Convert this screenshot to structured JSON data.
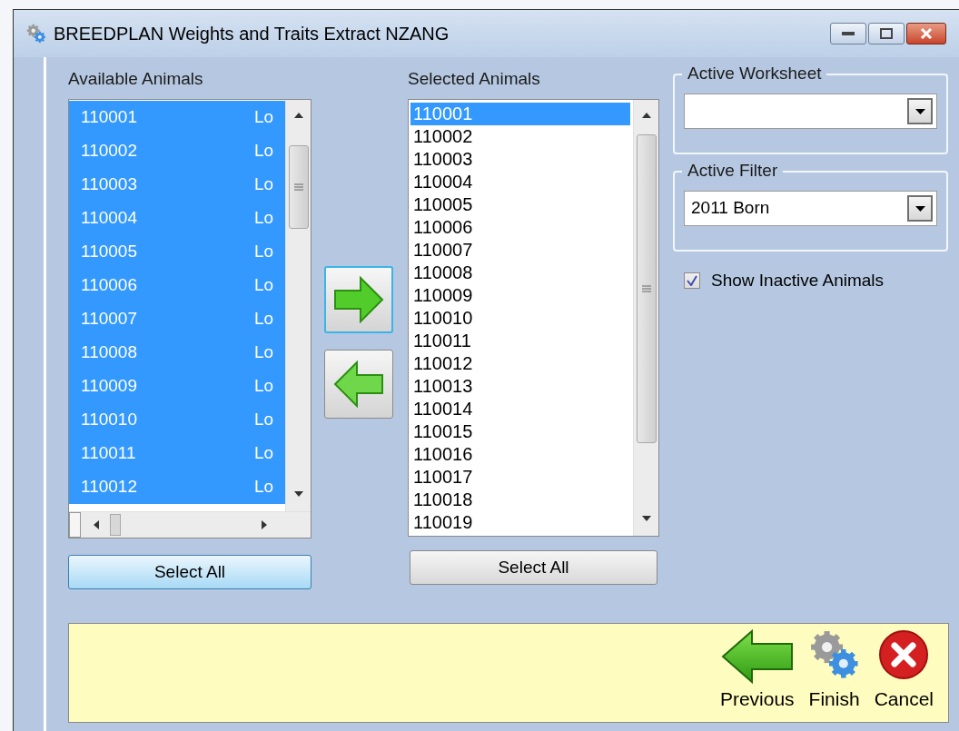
{
  "window": {
    "title": "BREEDPLAN Weights and Traits Extract NZANG"
  },
  "available_animals": {
    "label": "Available Animals",
    "select_all": "Select All",
    "rows": [
      {
        "id": "110001",
        "column_2": "Lo",
        "selected": true
      },
      {
        "id": "110002",
        "column_2": "Lo",
        "selected": true
      },
      {
        "id": "110003",
        "column_2": "Lo",
        "selected": true
      },
      {
        "id": "110004",
        "column_2": "Lo",
        "selected": true
      },
      {
        "id": "110005",
        "column_2": "Lo",
        "selected": true
      },
      {
        "id": "110006",
        "column_2": "Lo",
        "selected": true
      },
      {
        "id": "110007",
        "column_2": "Lo",
        "selected": true
      },
      {
        "id": "110008",
        "column_2": "Lo",
        "selected": true
      },
      {
        "id": "110009",
        "column_2": "Lo",
        "selected": true
      },
      {
        "id": "110010",
        "column_2": "Lo",
        "selected": true
      },
      {
        "id": "110011",
        "column_2": "Lo",
        "selected": true
      },
      {
        "id": "110012",
        "column_2": "Lo",
        "selected": true
      }
    ]
  },
  "selected_animals": {
    "label": "Selected Animals",
    "select_all": "Select All",
    "items": [
      {
        "text": "110001",
        "selected": true
      },
      {
        "text": "110002",
        "selected": false
      },
      {
        "text": "110003",
        "selected": false
      },
      {
        "text": "110004",
        "selected": false
      },
      {
        "text": "110005",
        "selected": false
      },
      {
        "text": "110006",
        "selected": false
      },
      {
        "text": "110007",
        "selected": false
      },
      {
        "text": "110008",
        "selected": false
      },
      {
        "text": "110009",
        "selected": false
      },
      {
        "text": "110010",
        "selected": false
      },
      {
        "text": "110011",
        "selected": false
      },
      {
        "text": "110012",
        "selected": false
      },
      {
        "text": "110013",
        "selected": false
      },
      {
        "text": "110014",
        "selected": false
      },
      {
        "text": "110015",
        "selected": false
      },
      {
        "text": "110016",
        "selected": false
      },
      {
        "text": "110017",
        "selected": false
      },
      {
        "text": "110018",
        "selected": false
      },
      {
        "text": "110019",
        "selected": false
      }
    ]
  },
  "active_worksheet": {
    "label": "Active Worksheet"
  },
  "active_filter": {
    "label": "Active Filter",
    "value": "2011 Born"
  },
  "show_inactive": {
    "label": "Show Inactive Animals",
    "checked": true
  },
  "footer_buttons": [
    {
      "kind": "previous",
      "label": "Previous"
    },
    {
      "kind": "finish",
      "label": "Finish"
    },
    {
      "kind": "cancel",
      "label": "Cancel"
    }
  ]
}
